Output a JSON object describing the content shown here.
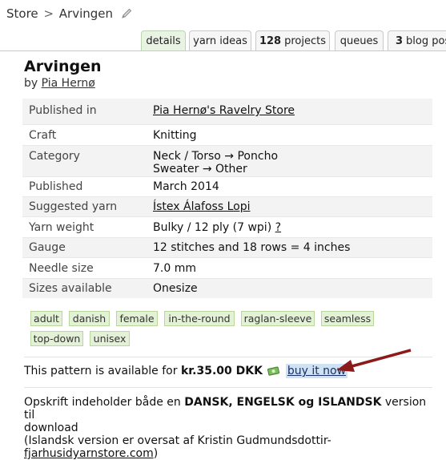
{
  "breadcrumb": {
    "store": "Store",
    "separator": ">",
    "current": "Arvingen"
  },
  "tabs": [
    {
      "label": "details",
      "count": ""
    },
    {
      "label": "yarn ideas",
      "count": ""
    },
    {
      "label": "projects",
      "count": "128"
    },
    {
      "label": "queues",
      "count": ""
    },
    {
      "label": "blog pos",
      "count": "3"
    }
  ],
  "pattern": {
    "title": "Arvingen",
    "by_prefix": "by",
    "designer": "Pia Hernø"
  },
  "details": [
    {
      "label": "Published in",
      "value": "Pia Hernø's Ravelry Store"
    },
    {
      "label": "Craft",
      "value": "Knitting"
    },
    {
      "label": "Category",
      "value": "Neck / Torso → Poncho",
      "value2": "Sweater → Other"
    },
    {
      "label": "Published",
      "value": "March 2014"
    },
    {
      "label": "Suggested yarn",
      "value": "Ístex Álafoss Lopi"
    },
    {
      "label": "Yarn weight",
      "value": "Bulky / 12 ply (7 wpi)",
      "help": "?"
    },
    {
      "label": "Gauge",
      "value": "12 stitches and 18 rows = 4 inches"
    },
    {
      "label": "Needle size",
      "value": "7.0 mm"
    },
    {
      "label": "Sizes available",
      "value": "Onesize"
    }
  ],
  "tags": [
    "adult",
    "danish",
    "female",
    "in-the-round",
    "raglan-sleeve",
    "seamless",
    "top-down",
    "unisex"
  ],
  "purchase": {
    "prefix": "This pattern is available for",
    "price": "kr.35.00 DKK",
    "buy_label": "buy it now"
  },
  "description": {
    "line1_prefix": "Opskrift indeholder både en",
    "line1_bold": "DANSK, ENGELSK og ISLANDSK",
    "line1_suffix": "version til",
    "line2": "download",
    "line3": "(Islandsk version er oversat af Kristin Gudmundsdottir-",
    "link": "fjarhusidyarnstore.com",
    "line4_suffix": ")"
  },
  "colors": {
    "tag_bg": "#e3f1d6",
    "active_tab_bg": "#e9f3e3",
    "buy_highlight": "#cfe2f3",
    "arrow": "#8b1a1a"
  },
  "icons": [
    "pencil-icon",
    "money-icon",
    "red-arrow-icon"
  ]
}
